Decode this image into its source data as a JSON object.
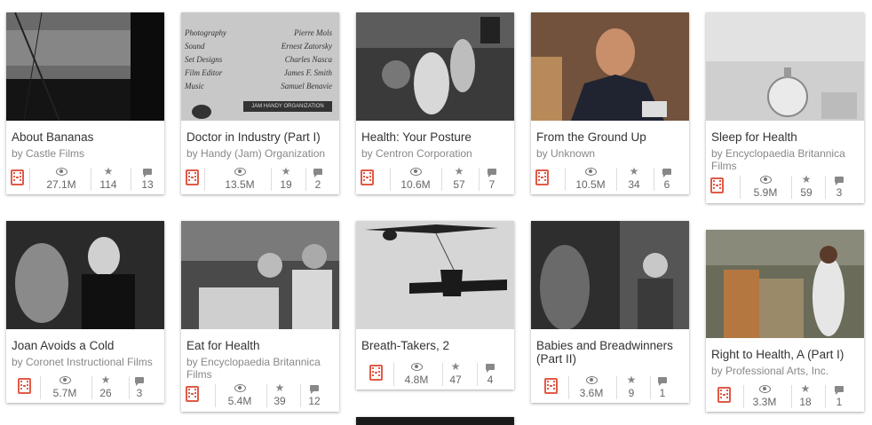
{
  "videos": [
    {
      "title": "About Bananas",
      "by": "by Castle Films",
      "views": "27.1M",
      "favorites": "114",
      "comments": "13"
    },
    {
      "title": "Doctor in Industry (Part I)",
      "by": "by Handy (Jam) Organization",
      "views": "13.5M",
      "favorites": "19",
      "comments": "2"
    },
    {
      "title": "Health: Your Posture",
      "by": "by Centron Corporation",
      "views": "10.6M",
      "favorites": "57",
      "comments": "7"
    },
    {
      "title": "From the Ground Up",
      "by": "by Unknown",
      "views": "10.5M",
      "favorites": "34",
      "comments": "6"
    },
    {
      "title": "Sleep for Health",
      "by": "by Encyclopaedia Britannica Films",
      "views": "5.9M",
      "favorites": "59",
      "comments": "3"
    },
    {
      "title": "Joan Avoids a Cold",
      "by": "by Coronet Instructional Films",
      "views": "5.7M",
      "favorites": "26",
      "comments": "3"
    },
    {
      "title": "Eat for Health",
      "by": "by Encyclopaedia Britannica Films",
      "views": "5.4M",
      "favorites": "39",
      "comments": "12"
    },
    {
      "title": "Breath-Takers, 2",
      "by": "",
      "views": "4.8M",
      "favorites": "47",
      "comments": "4"
    },
    {
      "title": "Babies and Breadwinners (Part II)",
      "by": "",
      "views": "3.6M",
      "favorites": "9",
      "comments": "1"
    },
    {
      "title": "Right to Health, A (Part I)",
      "by": "by Professional Arts, Inc.",
      "views": "3.3M",
      "favorites": "18",
      "comments": "1"
    }
  ],
  "credits": {
    "roles": [
      "Photography",
      "Sound",
      "Set Designs",
      "Film Editor",
      "Music"
    ],
    "names": [
      "Pierre Mols",
      "Ernest Zatorsky",
      "Charles Nasca",
      "James F. Smith",
      "Samuel Benavie"
    ],
    "footer": "JAM HANDY ORGANIZATION"
  },
  "icons": {
    "media": "film-icon",
    "views": "eye-icon",
    "favorites": "star-icon",
    "comments": "comment-icon"
  },
  "colors": {
    "film_icon": "#e05a47",
    "title": "#333333",
    "byline": "#888888"
  }
}
